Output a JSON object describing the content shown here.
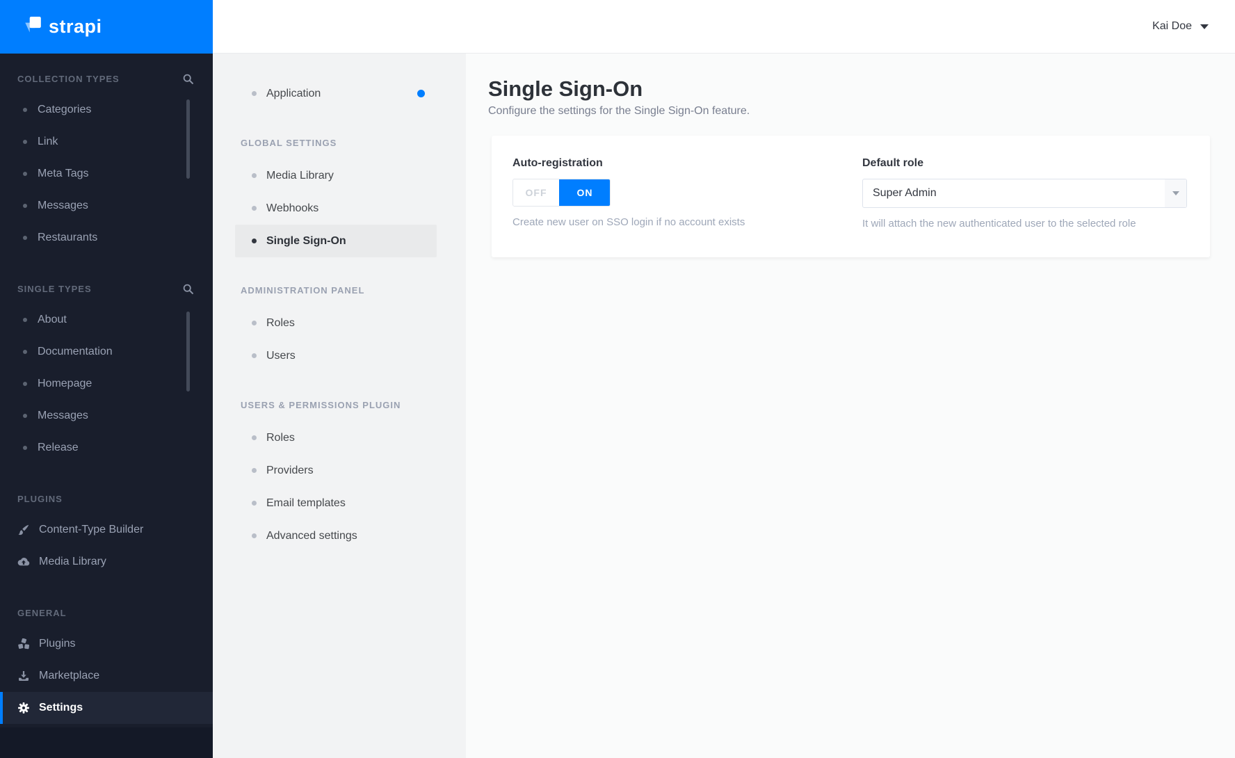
{
  "brand": {
    "name": "strapi"
  },
  "header": {
    "user_name": "Kai Doe"
  },
  "colors": {
    "accent_blue": "#007eff",
    "sidebar_bg": "#191e2c",
    "subsidebar_bg": "#f2f3f4",
    "toggle_on": "#007eff",
    "notification_dot": "#007eff"
  },
  "nav": {
    "collection_types": {
      "title": "COLLECTION TYPES",
      "items": [
        "Categories",
        "Link",
        "Meta Tags",
        "Messages",
        "Restaurants"
      ]
    },
    "single_types": {
      "title": "SINGLE TYPES",
      "items": [
        "About",
        "Documentation",
        "Homepage",
        "Messages",
        "Release"
      ]
    },
    "plugins": {
      "title": "PLUGINS",
      "items": [
        "Content-Type Builder",
        "Media Library"
      ]
    },
    "general": {
      "title": "GENERAL",
      "items": [
        "Plugins",
        "Marketplace",
        "Settings"
      ],
      "active_item": "Settings"
    }
  },
  "settings_nav": {
    "application": "Application",
    "global_settings": {
      "title": "GLOBAL SETTINGS",
      "items": [
        "Media Library",
        "Webhooks",
        "Single Sign-On"
      ],
      "active_item": "Single Sign-On"
    },
    "administration_panel": {
      "title": "ADMINISTRATION PANEL",
      "items": [
        "Roles",
        "Users"
      ]
    },
    "users_permissions": {
      "title": "USERS & PERMISSIONS PLUGIN",
      "items": [
        "Roles",
        "Providers",
        "Email templates",
        "Advanced settings"
      ]
    }
  },
  "content": {
    "title": "Single Sign-On",
    "subtitle": "Configure the settings for the Single Sign-On feature.",
    "auto_registration": {
      "label": "Auto-registration",
      "off_label": "OFF",
      "on_label": "ON",
      "value": "ON",
      "helper": "Create new user on SSO login if no account exists"
    },
    "default_role": {
      "label": "Default role",
      "value": "Super Admin",
      "helper": "It will attach the new authenticated user to the selected role"
    }
  }
}
